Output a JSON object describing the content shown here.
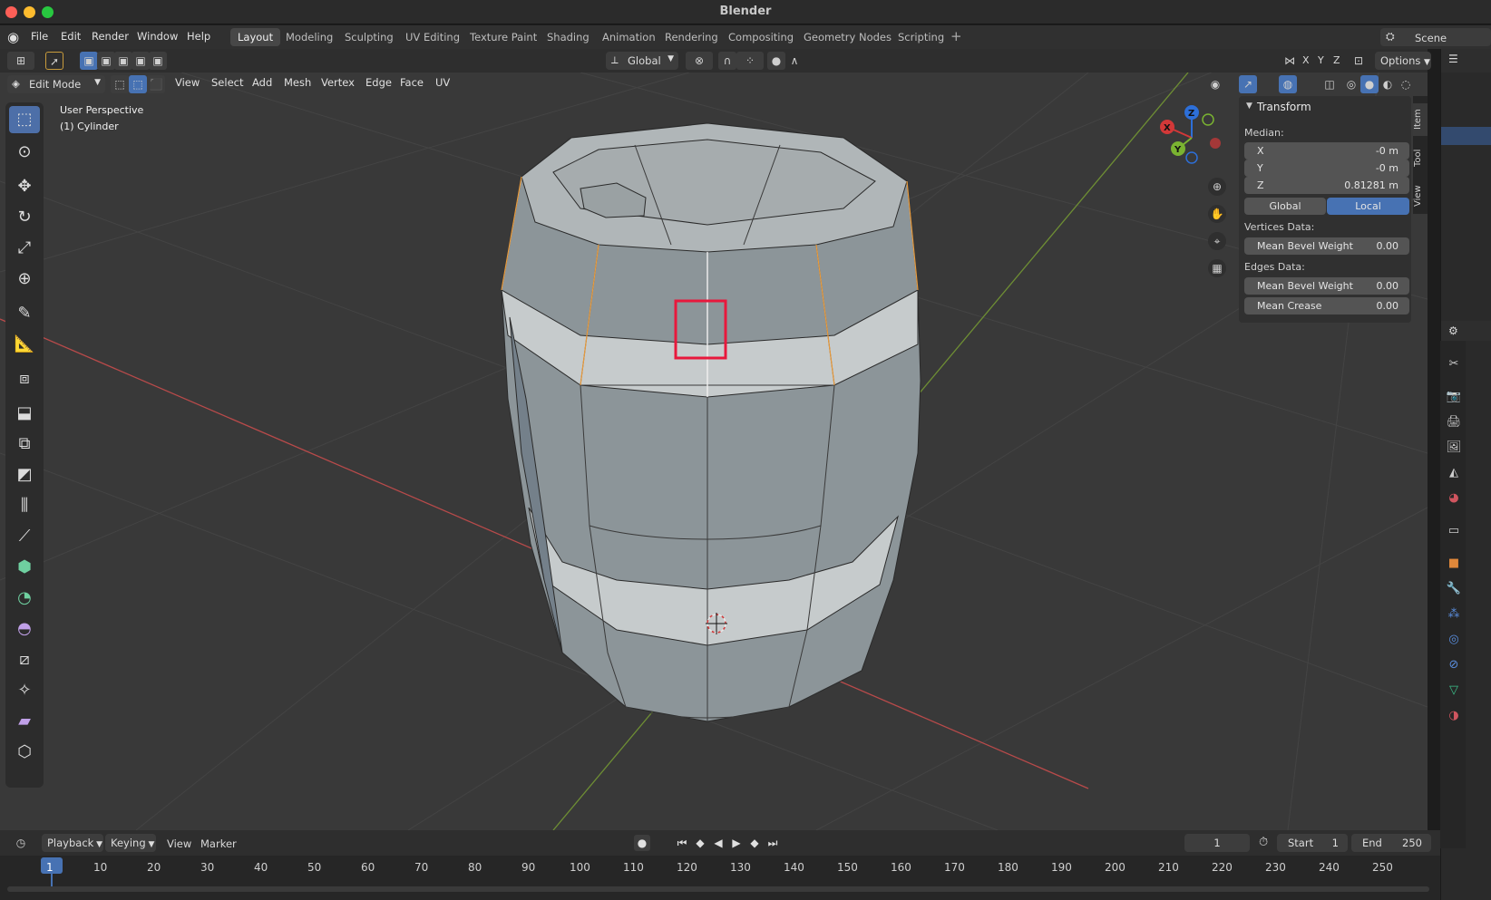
{
  "app_title": "Blender",
  "menu": [
    "File",
    "Edit",
    "Render",
    "Window",
    "Help"
  ],
  "workspaces": [
    "Layout",
    "Modeling",
    "Sculpting",
    "UV Editing",
    "Texture Paint",
    "Shading",
    "Animation",
    "Rendering",
    "Compositing",
    "Geometry Nodes",
    "Scripting"
  ],
  "active_workspace": "Layout",
  "scene_name": "Scene",
  "tool_header": {
    "orientation": "Global",
    "options_label": "Options",
    "axes": [
      "X",
      "Y",
      "Z"
    ]
  },
  "view3d_header": {
    "mode": "Edit Mode",
    "menus": [
      "View",
      "Select",
      "Add",
      "Mesh",
      "Vertex",
      "Edge",
      "Face",
      "UV"
    ]
  },
  "viewport": {
    "perspective_label": "User Perspective",
    "object_label": "(1) Cylinder"
  },
  "gizmo": {
    "x": "X",
    "y": "Y",
    "z": "Z"
  },
  "npanel": {
    "panel_title": "Transform",
    "median_label": "Median:",
    "x": {
      "label": "X",
      "value": "-0 m"
    },
    "y": {
      "label": "Y",
      "value": "-0 m"
    },
    "z": {
      "label": "Z",
      "value": "0.81281 m"
    },
    "space_global": "Global",
    "space_local": "Local",
    "vertices_data_label": "Vertices Data:",
    "vert_bevel": {
      "label": "Mean Bevel Weight",
      "value": "0.00"
    },
    "edges_data_label": "Edges Data:",
    "edge_bevel": {
      "label": "Mean Bevel Weight",
      "value": "0.00"
    },
    "edge_crease": {
      "label": "Mean Crease",
      "value": "0.00"
    },
    "tabs": [
      "Item",
      "Tool",
      "View"
    ]
  },
  "timeline": {
    "menus": [
      "Playback",
      "Keying",
      "View",
      "Marker"
    ],
    "current_frame": "1",
    "start_label": "Start",
    "start_value": "1",
    "end_label": "End",
    "end_value": "250",
    "ruler": [
      "1",
      "10",
      "20",
      "30",
      "40",
      "50",
      "60",
      "70",
      "80",
      "90",
      "100",
      "110",
      "120",
      "130",
      "140",
      "150",
      "160",
      "170",
      "180",
      "190",
      "200",
      "210",
      "220",
      "230",
      "240",
      "250"
    ]
  },
  "colors": {
    "accent": "#4772b3",
    "selection_box": "#e8183c",
    "active_tool": "#4d6fa8"
  }
}
